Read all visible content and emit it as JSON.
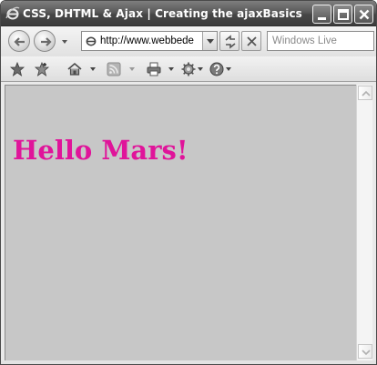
{
  "window": {
    "title": "CSS, DHTML & Ajax | Creating the ajaxBasics.js ..."
  },
  "address_bar": {
    "url": "http://www.webbede"
  },
  "search": {
    "placeholder": "Windows Live"
  },
  "icons": {
    "title": "ie-logo-icon",
    "back": "back-arrow-icon",
    "forward": "forward-arrow-icon",
    "refresh": "refresh-icon",
    "stop": "stop-icon",
    "favorites": "favorites-star-icon",
    "add_favorites": "add-favorites-icon",
    "home": "home-icon",
    "feeds": "rss-feeds-icon",
    "print": "print-icon",
    "tools": "tools-gear-icon",
    "help": "help-icon"
  },
  "page": {
    "heading": "Hello Mars!",
    "heading_color": "#e0149a",
    "background_color": "#c7c7c7"
  }
}
